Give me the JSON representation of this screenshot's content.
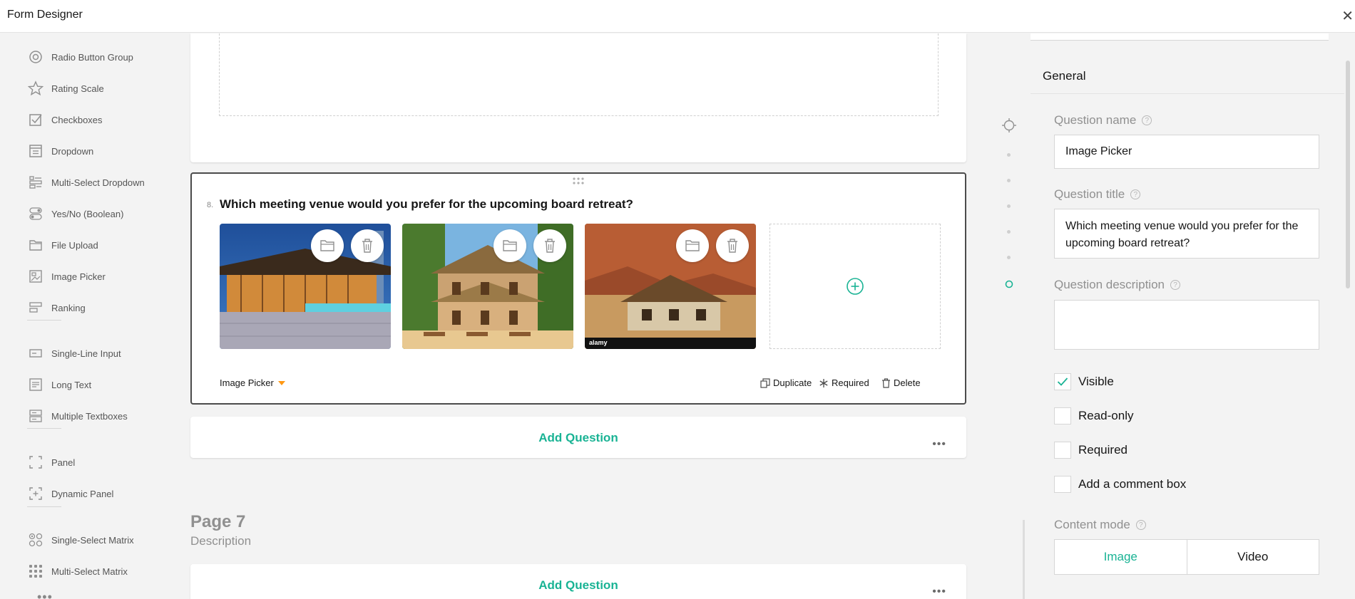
{
  "window": {
    "title": "Form Designer",
    "close_glyph": "✕"
  },
  "toolbox": {
    "items": [
      {
        "label": "Radio Button Group",
        "icon": "radio-icon"
      },
      {
        "label": "Rating Scale",
        "icon": "star-icon"
      },
      {
        "label": "Checkboxes",
        "icon": "checkbox-icon"
      },
      {
        "label": "Dropdown",
        "icon": "dropdown-icon"
      },
      {
        "label": "Multi-Select Dropdown",
        "icon": "tag-list-icon"
      },
      {
        "label": "Yes/No (Boolean)",
        "icon": "toggle-icon"
      },
      {
        "label": "File Upload",
        "icon": "folder-icon"
      },
      {
        "label": "Image Picker",
        "icon": "image-icon"
      },
      {
        "label": "Ranking",
        "icon": "ranking-icon"
      },
      {
        "label": "Single-Line Input",
        "icon": "textbox-icon"
      },
      {
        "label": "Long Text",
        "icon": "comment-icon"
      },
      {
        "label": "Multiple Textboxes",
        "icon": "multitext-icon"
      },
      {
        "label": "Panel",
        "icon": "panel-icon"
      },
      {
        "label": "Dynamic Panel",
        "icon": "dynamic-panel-icon"
      },
      {
        "label": "Single-Select Matrix",
        "icon": "matrix-icon"
      },
      {
        "label": "Multi-Select Matrix",
        "icon": "matrix-dots-icon"
      }
    ],
    "more_glyph": "•••"
  },
  "question": {
    "number": "8.",
    "title": "Which meeting venue would you prefer for the upcoming board retreat?",
    "type_label": "Image Picker",
    "actions": {
      "duplicate": "Duplicate",
      "required": "Required",
      "delete": "Delete"
    },
    "images": [
      {
        "scene": "modern-pavilion-at-dusk"
      },
      {
        "scene": "tropical-thatched-villa"
      },
      {
        "scene": "desert-lodge-watermark",
        "watermark": "alamy"
      }
    ]
  },
  "canvas": {
    "add_question_label": "Add Question",
    "more_glyph": "•••",
    "next_page": {
      "title": "Page 7",
      "description": "Description"
    }
  },
  "properties": {
    "section_title": "General",
    "question_name": {
      "label": "Question name",
      "value": "Image Picker"
    },
    "question_title": {
      "label": "Question title",
      "value": "Which meeting venue would you prefer for the upcoming board retreat?"
    },
    "question_description": {
      "label": "Question description",
      "value": ""
    },
    "checks": [
      {
        "label": "Visible",
        "checked": true
      },
      {
        "label": "Read-only",
        "checked": false
      },
      {
        "label": "Required",
        "checked": false
      },
      {
        "label": "Add a comment box",
        "checked": false
      }
    ],
    "content_mode": {
      "label": "Content mode",
      "options": [
        "Image",
        "Video"
      ],
      "selected": "Image"
    },
    "help_glyph": "?"
  },
  "colors": {
    "accent": "#19b394",
    "text": "#161616",
    "muted": "#909090",
    "icon": "#909090",
    "warning_arrow": "#ff9814"
  }
}
